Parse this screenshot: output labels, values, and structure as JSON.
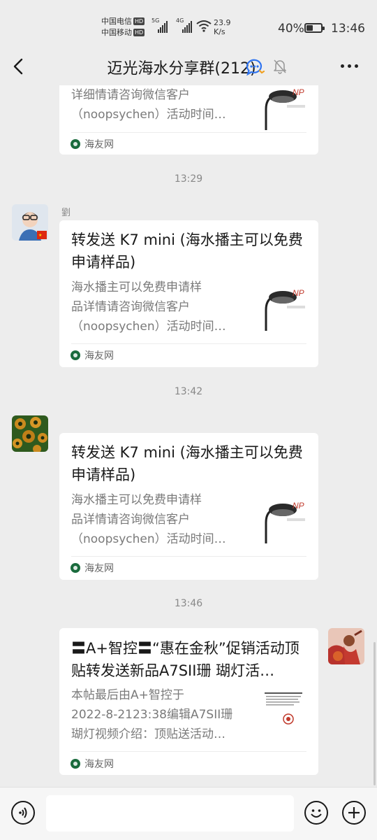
{
  "status": {
    "carrier1": "中国电信",
    "carrier2": "中国移动",
    "hd": "HD",
    "net1": "5G",
    "net2": "4G",
    "speed_value": "23.9",
    "speed_unit": "K/s",
    "battery": "40%",
    "battery_level": 0.4,
    "time": "13:46"
  },
  "header": {
    "title": "迈光海水分享群(212)"
  },
  "messages": [
    {
      "desc": "详细情请咨询微信客户\n（noopsychen）活动时间…",
      "source": "海友网"
    },
    {
      "time": "13:29",
      "sender": "劉",
      "title": "转发送 K7 mini (海水播主可以免费申请样品)",
      "desc": "海水播主可以免费申请样\n品详情请咨询微信客户\n（noopsychen）活动时间…",
      "source": "海友网"
    },
    {
      "time": "13:42",
      "title": "转发送 K7 mini (海水播主可以免费申请样品)",
      "desc": "海水播主可以免费申请样\n品详情请咨询微信客户\n（noopsychen）活动时间…",
      "source": "海友网"
    },
    {
      "time": "13:46",
      "title": "〓A+智控〓“惠在金秋”促销活动顶贴转发送新品A7SII珊 瑚灯活…",
      "desc": "本帖最后由A+智控于\n2022-8-2123:38编辑A7SII珊\n瑚灯视频介绍：顶贴送活动…",
      "source": "海友网"
    }
  ],
  "icons": {
    "back": "chevron-left-icon",
    "group_chat": "chat-bubble-icon",
    "mute": "bell-off-icon",
    "more": "more-dots-icon",
    "voice": "voice-icon",
    "emoji": "emoji-icon",
    "add": "plus-icon"
  },
  "colors": {
    "background": "#ededed",
    "card": "#ffffff",
    "source_icon": "#1a6b3d"
  }
}
